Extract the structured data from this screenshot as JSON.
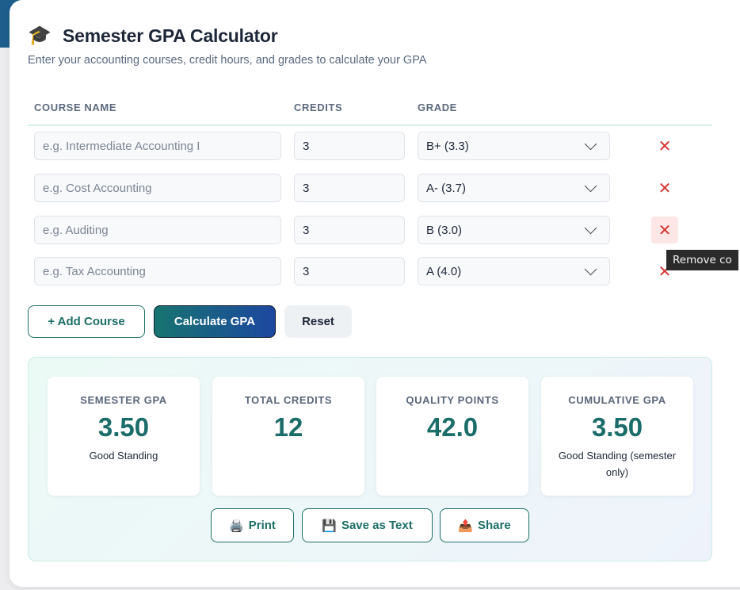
{
  "header": {
    "icon": "graduation-cap-icon",
    "title": "Semester GPA Calculator",
    "subtitle": "Enter your accounting courses, credit hours, and grades to calculate your GPA"
  },
  "table": {
    "columns": [
      "COURSE NAME",
      "CREDITS",
      "GRADE"
    ],
    "rows": [
      {
        "course_placeholder": "e.g. Intermediate Accounting I",
        "credits": "3",
        "grade": "B+ (3.3)"
      },
      {
        "course_placeholder": "e.g. Cost Accounting",
        "credits": "3",
        "grade": "A- (3.7)"
      },
      {
        "course_placeholder": "e.g. Auditing",
        "credits": "3",
        "grade": "B (3.0)"
      },
      {
        "course_placeholder": "e.g. Tax Accounting",
        "credits": "3",
        "grade": "A (4.0)"
      }
    ],
    "remove_glyph": "✕"
  },
  "tooltip": "Remove co",
  "buttons": {
    "add": "+ Add Course",
    "calculate": "Calculate GPA",
    "reset": "Reset"
  },
  "results": {
    "stats": [
      {
        "label": "SEMESTER GPA",
        "value": "3.50",
        "note": "Good Standing"
      },
      {
        "label": "TOTAL CREDITS",
        "value": "12",
        "note": ""
      },
      {
        "label": "QUALITY POINTS",
        "value": "42.0",
        "note": ""
      },
      {
        "label": "CUMULATIVE GPA",
        "value": "3.50",
        "note": "Good Standing (semester only)"
      }
    ],
    "actions": [
      {
        "icon": "🖨️",
        "label": "Print"
      },
      {
        "icon": "💾",
        "label": "Save as Text"
      },
      {
        "icon": "📤",
        "label": "Share"
      }
    ]
  },
  "colors": {
    "accent_teal": "#1b6d69",
    "accent_blue": "#1d47a0",
    "danger": "#d73333"
  }
}
